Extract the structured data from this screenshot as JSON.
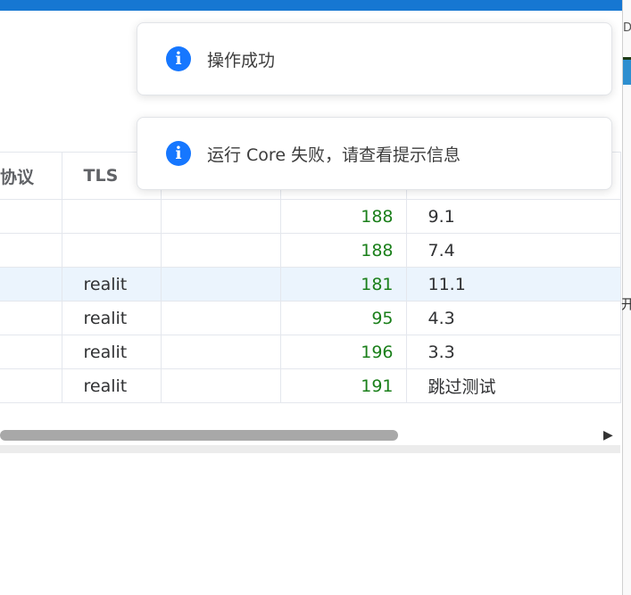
{
  "table": {
    "headers": [
      "协议",
      "TLS",
      "",
      "",
      ""
    ],
    "rows": [
      {
        "tls": "",
        "delay": "188",
        "speed": "9.1",
        "highlight": false
      },
      {
        "tls": "",
        "delay": "188",
        "speed": "7.4",
        "highlight": false
      },
      {
        "tls": "realit",
        "delay": "181",
        "speed": "11.1",
        "highlight": true
      },
      {
        "tls": "realit",
        "delay": "95",
        "speed": "4.3",
        "highlight": false
      },
      {
        "tls": "realit",
        "delay": "196",
        "speed": "3.3",
        "highlight": false
      },
      {
        "tls": "realit",
        "delay": "191",
        "speed": "跳过测试",
        "highlight": false
      }
    ]
  },
  "toasts": [
    {
      "icon": "info-icon",
      "message": "操作成功"
    },
    {
      "icon": "info-icon",
      "message": "运行 Core 失败，请查看提示信息"
    }
  ],
  "edge": {
    "letter": "D",
    "char": "开"
  },
  "colors": {
    "accent": "#1677d2",
    "delay_green": "#1a7f1a",
    "toast_icon": "#1677ff"
  }
}
